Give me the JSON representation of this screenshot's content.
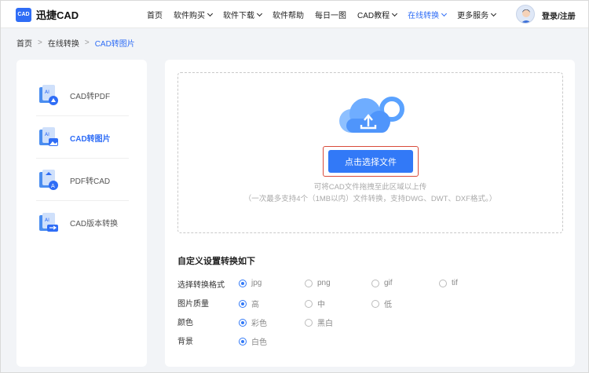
{
  "header": {
    "logo_badge": "CAD",
    "logo_text": "迅捷CAD",
    "nav": [
      {
        "label": "首页",
        "dropdown": false,
        "active": false
      },
      {
        "label": "软件购买",
        "dropdown": true,
        "active": false
      },
      {
        "label": "软件下载",
        "dropdown": true,
        "active": false
      },
      {
        "label": "软件帮助",
        "dropdown": false,
        "active": false
      },
      {
        "label": "每日一图",
        "dropdown": false,
        "active": false
      },
      {
        "label": "CAD教程",
        "dropdown": true,
        "active": false
      },
      {
        "label": "在线转换",
        "dropdown": true,
        "active": true
      },
      {
        "label": "更多服务",
        "dropdown": true,
        "active": false
      }
    ],
    "login_label": "登录/注册"
  },
  "breadcrumb": [
    "首页",
    "在线转换",
    "CAD转图片"
  ],
  "sidebar": {
    "items": [
      {
        "label": "CAD转PDF",
        "icon": "cad-to-pdf-icon",
        "active": false
      },
      {
        "label": "CAD转图片",
        "icon": "cad-to-image-icon",
        "active": true
      },
      {
        "label": "PDF转CAD",
        "icon": "pdf-to-cad-icon",
        "active": false
      },
      {
        "label": "CAD版本转换",
        "icon": "cad-version-icon",
        "active": false
      }
    ]
  },
  "upload": {
    "button_label": "点击选择文件",
    "hint_line1": "可将CAD文件拖拽至此区域以上传",
    "hint_line2": "（一次最多支持4个（1MB以内）文件转换，支持DWG、DWT、DXF格式。）"
  },
  "settings": {
    "title": "自定义设置转换如下",
    "rows": [
      {
        "label": "选择转换格式",
        "options": [
          "jpg",
          "png",
          "gif",
          "tif"
        ],
        "selected": 0
      },
      {
        "label": "图片质量",
        "options": [
          "高",
          "中",
          "低"
        ],
        "selected": 0
      },
      {
        "label": "颜色",
        "options": [
          "彩色",
          "黑白"
        ],
        "selected": 0
      },
      {
        "label": "背景",
        "options": [
          "白色"
        ],
        "selected": 0
      }
    ]
  },
  "colors": {
    "accent": "#2f6df6",
    "button": "#3279f7",
    "highlight_border": "#d94a3a"
  }
}
